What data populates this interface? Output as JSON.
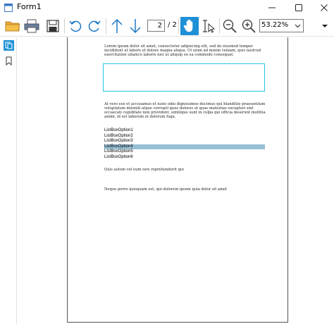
{
  "window": {
    "title": "Form1",
    "minimize_glyph": "—",
    "maximize_glyph": "☐",
    "close_glyph": "✕"
  },
  "toolbar": {
    "icons": [
      "open-folder-icon",
      "print-icon",
      "save-icon",
      "undo-icon",
      "redo-icon",
      "arrow-up-icon",
      "arrow-down-icon",
      "hand-icon",
      "text-select-icon",
      "zoom-out-icon",
      "zoom-in-icon",
      "chevron-down-icon",
      "overflow-icon"
    ],
    "page_number": "2",
    "page_total": "/ 2",
    "zoom_value": "53.22%"
  },
  "sidebar": {
    "icons": [
      "thumbnails-icon",
      "bookmark-icon"
    ]
  },
  "document": {
    "paragraph1": "Lorem ipsum dolor sit amet, consectetur adipiscing elit, sed do eiusmod tempor incididunt ut labore et dolore magna aliqua. Ut enim ad minim veniam, quis nostrud exercitation ullamco laboris nisi ut aliquip ex ea commodo consequat.",
    "paragraph2": "At vero eos et accusamus et iusto odio dignissimos ducimus qui blanditiis praesentium voluptatum deleniti atque corrupti quos dolores et quas molestias excepturi sint occaecati cupiditate non provident, similique sunt in culpa qui officia deserunt mollitia animi, id est laborum et dolorum fuga.",
    "list_items": [
      "ListBoxOption1",
      "ListBoxOption2",
      "ListBoxOption3",
      "ListBoxOption4",
      "ListBoxOption5",
      "ListBoxOption6"
    ],
    "selected_index": 3,
    "paragraph3": "Quis autem vel eum iure reprehenderit qui",
    "paragraph4": "Neque porro quisquam est, qui dolorem ipsum quia dolor sit amet"
  },
  "colors": {
    "accent": "#1e90d6",
    "textbox_border": "#25c6e6",
    "list_selection": "#98bfd6"
  }
}
